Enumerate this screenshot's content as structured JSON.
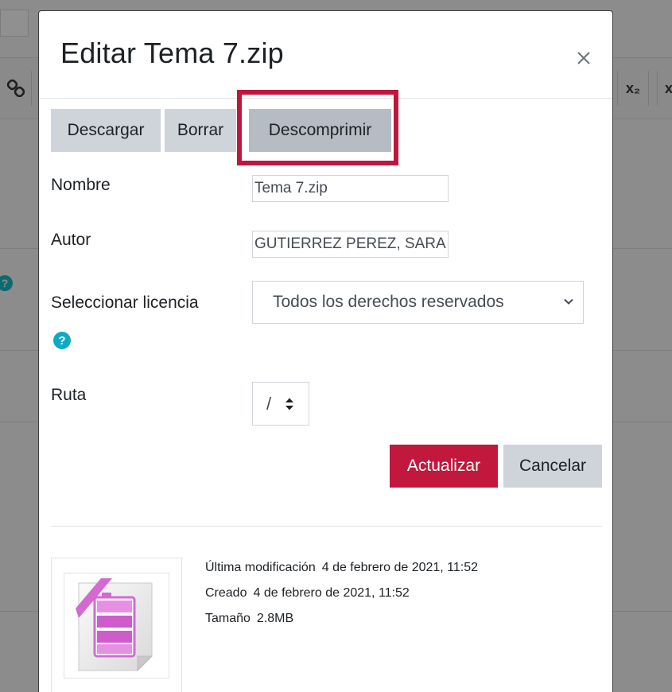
{
  "background_toolbar": {
    "link_icon": "link-icon",
    "subscript_label": "x₂",
    "superscript_label": "x"
  },
  "dialog": {
    "title": "Editar Tema 7.zip",
    "close_icon": "close-icon",
    "actions": {
      "download_label": "Descargar",
      "delete_label": "Borrar",
      "unzip_label": "Descomprimir"
    },
    "fields": {
      "name_label": "Nombre",
      "name_value": "Tema 7.zip",
      "author_label": "Autor",
      "author_value": "GUTIERREZ PEREZ, SARA M",
      "license_label": "Seleccionar licencia",
      "license_value": "Todos los derechos reservados",
      "path_label": "Ruta",
      "path_value": "/"
    },
    "buttons": {
      "update_label": "Actualizar",
      "cancel_label": "Cancelar"
    },
    "file_info": {
      "modified_label": "Última modificación",
      "modified_value": "4 de febrero de 2021, 11:52",
      "created_label": "Creado",
      "created_value": "4 de febrero de 2021, 11:52",
      "size_label": "Tamaño",
      "size_value": "2.8MB"
    }
  },
  "colors": {
    "primary_red": "#c3183d",
    "secondary_gray": "#ced4da",
    "help_blue": "#0fa9c6",
    "archive_pink": "#d46ad0"
  }
}
